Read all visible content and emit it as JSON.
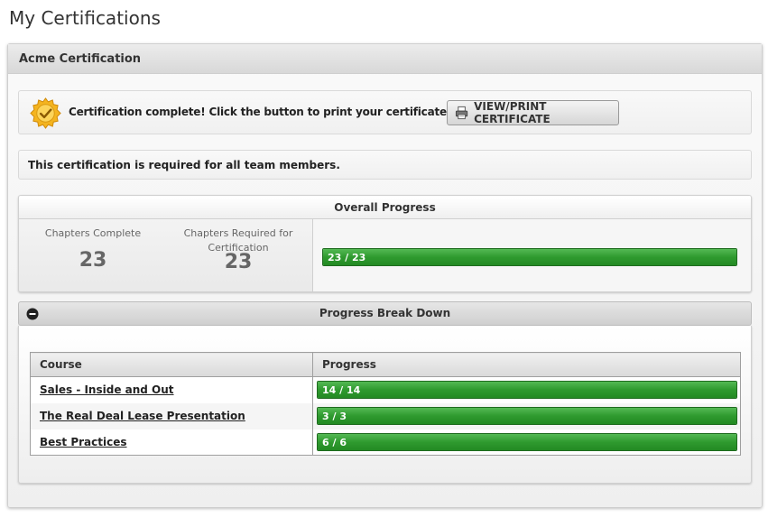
{
  "page": {
    "title": "My Certifications"
  },
  "panel": {
    "title": "Acme Certification"
  },
  "completion": {
    "message": "Certification complete! Click the button to print your certificate.",
    "button_label": "VIEW/PRINT CERTIFICATE",
    "seal_icon": "certificate-seal-icon",
    "button_icon": "printer-icon"
  },
  "requirement": {
    "message": "This certification is required for all team members."
  },
  "overall": {
    "title": "Overall Progress",
    "chapters_complete_label": "Chapters Complete",
    "chapters_complete_value": "23",
    "chapters_required_label": "Chapters Required for Certification",
    "chapters_required_value": "23",
    "progress_label": "23 / 23",
    "progress_fraction": 1.0
  },
  "breakdown": {
    "title": "Progress Break Down",
    "toggle_icon": "collapse-minus-icon",
    "columns": [
      "Course",
      "Progress"
    ],
    "rows": [
      {
        "course": "Sales - Inside and Out",
        "progress_label": "14 / 14",
        "progress_fraction": 1.0
      },
      {
        "course": "The Real Deal Lease Presentation",
        "progress_label": "3 / 3",
        "progress_fraction": 1.0
      },
      {
        "course": "Best Practices",
        "progress_label": "6 / 6",
        "progress_fraction": 1.0
      }
    ]
  },
  "colors": {
    "progress_fill": "#2f9a2f",
    "progress_border": "#1f6b1f",
    "seal_gold": "#f2b01e"
  }
}
